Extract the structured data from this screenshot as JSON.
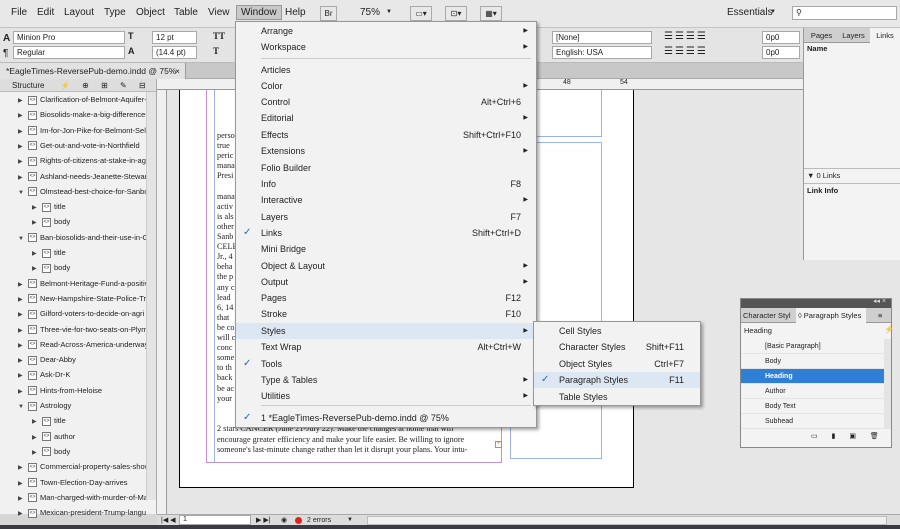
{
  "menubar": {
    "items": [
      "File",
      "Edit",
      "Layout",
      "Type",
      "Object",
      "Table",
      "View",
      "Window",
      "Help"
    ],
    "active": "Window",
    "br_label": "Br",
    "zoom": "75%",
    "workspace": "Essentials"
  },
  "control": {
    "font": "Minion Pro",
    "style": "Regular",
    "size": "12 pt",
    "leading": "(14.4 pt)",
    "tt1": "TT",
    "tt2": "T",
    "none": "[None]",
    "language": "English: USA",
    "val1": "0p0",
    "val2": "0p0",
    "val3": "0",
    "val4": "0p0",
    "val5": "0p0"
  },
  "doc_tab": "*EagleTimes-ReversePub-demo.indd @ 75%",
  "ruler": {
    "t48": "48",
    "t54": "54"
  },
  "structure": {
    "header": "Structure",
    "rows": [
      {
        "label": "Clarification-of-Belmont-Aquifer-",
        "indent": 0,
        "tri": "▶"
      },
      {
        "label": "Biosolids-make-a-big-difference-",
        "indent": 0,
        "tri": "▶"
      },
      {
        "label": "Im-for-Jon-Pike-for-Belmont-Sele",
        "indent": 0,
        "tri": "▶"
      },
      {
        "label": "Get-out-and-vote-in-Northfield",
        "indent": 0,
        "tri": "▶"
      },
      {
        "label": "Rights-of-citizens-at-stake-in-agri",
        "indent": 0,
        "tri": "▶"
      },
      {
        "label": "Ashland-needs-Jeanette-Stewart",
        "indent": 0,
        "tri": "▶"
      },
      {
        "label": "Olmstead-best-choice-for-Sanbor",
        "indent": 0,
        "tri": "▼"
      },
      {
        "label": "title",
        "indent": 1,
        "tri": "▶"
      },
      {
        "label": "body",
        "indent": 1,
        "tri": "▶"
      },
      {
        "label": "Ban-biosolids-and-their-use-in-Gil",
        "indent": 0,
        "tri": "▼"
      },
      {
        "label": "title",
        "indent": 1,
        "tri": "▶"
      },
      {
        "label": "body",
        "indent": 1,
        "tri": "▶"
      },
      {
        "label": "Belmont-Heritage-Fund-a-positiv",
        "indent": 0,
        "tri": "▶"
      },
      {
        "label": "New-Hampshire-State-Police-Tr",
        "indent": 0,
        "tri": "▶"
      },
      {
        "label": "Gilford-voters-to-decide-on-agri",
        "indent": 0,
        "tri": "▶"
      },
      {
        "label": "Three-vie-for-two-seats-on-Plym",
        "indent": 0,
        "tri": "▶"
      },
      {
        "label": "Read-Across-America-underway",
        "indent": 0,
        "tri": "▶"
      },
      {
        "label": "Dear-Abby",
        "indent": 0,
        "tri": "▶"
      },
      {
        "label": "Ask-Dr-K",
        "indent": 0,
        "tri": "▶"
      },
      {
        "label": "Hints-from-Heloise",
        "indent": 0,
        "tri": "▶"
      },
      {
        "label": "Astrology",
        "indent": 0,
        "tri": "▼"
      },
      {
        "label": "title",
        "indent": 1,
        "tri": "▶"
      },
      {
        "label": "author",
        "indent": 1,
        "tri": "▶"
      },
      {
        "label": "body",
        "indent": 1,
        "tri": "▶"
      },
      {
        "label": "Commercial-property-sales-show",
        "indent": 0,
        "tri": "▶"
      },
      {
        "label": "Town-Election-Day-arrives",
        "indent": 0,
        "tri": "▶"
      },
      {
        "label": "Man-charged-with-murder-of-Ma",
        "indent": 0,
        "tri": "▶"
      },
      {
        "label": "Mexican-president-Trump-langua",
        "indent": 0,
        "tri": "▶"
      }
    ]
  },
  "window_menu": {
    "items": [
      {
        "label": "Arrange",
        "shortcut": "",
        "submenu": true,
        "check": false
      },
      {
        "label": "Workspace",
        "shortcut": "",
        "submenu": true,
        "check": false
      },
      {
        "label": "Articles",
        "shortcut": "",
        "submenu": false,
        "check": false
      },
      {
        "label": "Color",
        "shortcut": "",
        "submenu": true,
        "check": false
      },
      {
        "label": "Control",
        "shortcut": "Alt+Ctrl+6",
        "submenu": false,
        "check": false
      },
      {
        "label": "Editorial",
        "shortcut": "",
        "submenu": true,
        "check": false
      },
      {
        "label": "Effects",
        "shortcut": "Shift+Ctrl+F10",
        "submenu": false,
        "check": false
      },
      {
        "label": "Extensions",
        "shortcut": "",
        "submenu": true,
        "check": false
      },
      {
        "label": "Folio Builder",
        "shortcut": "",
        "submenu": false,
        "check": false
      },
      {
        "label": "Info",
        "shortcut": "F8",
        "submenu": false,
        "check": false
      },
      {
        "label": "Interactive",
        "shortcut": "",
        "submenu": true,
        "check": false
      },
      {
        "label": "Layers",
        "shortcut": "F7",
        "submenu": false,
        "check": false
      },
      {
        "label": "Links",
        "shortcut": "Shift+Ctrl+D",
        "submenu": false,
        "check": true
      },
      {
        "label": "Mini Bridge",
        "shortcut": "",
        "submenu": false,
        "check": false
      },
      {
        "label": "Object & Layout",
        "shortcut": "",
        "submenu": true,
        "check": false
      },
      {
        "label": "Output",
        "shortcut": "",
        "submenu": true,
        "check": false
      },
      {
        "label": "Pages",
        "shortcut": "F12",
        "submenu": false,
        "check": false
      },
      {
        "label": "Stroke",
        "shortcut": "F10",
        "submenu": false,
        "check": false
      },
      {
        "label": "Styles",
        "shortcut": "",
        "submenu": true,
        "check": false,
        "highlight": true
      },
      {
        "label": "Text Wrap",
        "shortcut": "Alt+Ctrl+W",
        "submenu": false,
        "check": false
      },
      {
        "label": "Tools",
        "shortcut": "",
        "submenu": false,
        "check": true
      },
      {
        "label": "Type & Tables",
        "shortcut": "",
        "submenu": true,
        "check": false
      },
      {
        "label": "Utilities",
        "shortcut": "",
        "submenu": true,
        "check": false
      },
      {
        "label": "1 *EagleTimes-ReversePub-demo.indd @ 75%",
        "shortcut": "",
        "submenu": false,
        "check": true
      }
    ]
  },
  "styles_submenu": {
    "items": [
      {
        "label": "Cell Styles",
        "shortcut": "",
        "check": false
      },
      {
        "label": "Character Styles",
        "shortcut": "Shift+F11",
        "check": false
      },
      {
        "label": "Object Styles",
        "shortcut": "Ctrl+F7",
        "check": false
      },
      {
        "label": "Paragraph Styles",
        "shortcut": "F11",
        "check": true
      },
      {
        "label": "Table Styles",
        "shortcut": "",
        "check": false
      }
    ]
  },
  "links_panel": {
    "tabs": [
      "Pages",
      "Layers",
      "Links"
    ],
    "col_name": "Name",
    "count": "0 Links",
    "info": "Link Info"
  },
  "para_panel": {
    "tab1": "Character Styl",
    "tab2": "◊ Paragraph Styles",
    "current": "Heading",
    "styles": [
      "[Basic Paragraph]",
      "Body",
      "Heading",
      "Author",
      "Body Text",
      "Subhead"
    ],
    "selected": "Heading"
  },
  "document": {
    "lines_left": [
      "perso",
      "true",
      "peric",
      "mana",
      "Presi",
      "",
      "mana",
      "activ",
      "is als",
      "other",
      "Sanb",
      "CELE",
      "Jr., 4",
      "beha",
      "the p",
      "any c",
      "lead",
      "6, 14",
      "that",
      "be co",
      "will c",
      "conc",
      "some",
      "to th",
      "back",
      "be ac",
      "your"
    ],
    "bottom_lines": [
      "2 stars   CANCER (June 21-July 22): Make the changes at home that will",
      "encourage greater efficiency and make your life easier. Be willing to ignore",
      "someone's last-minute change rather than let it disrupt your plans. Your intu-"
    ]
  },
  "status": {
    "page": "1",
    "errors": "2 errors"
  }
}
